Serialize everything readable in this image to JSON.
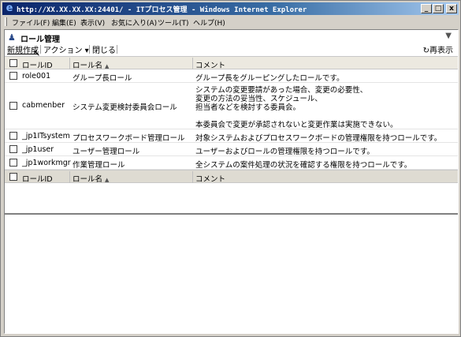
{
  "window": {
    "title": "http://XX.XX.XX.XX:24401/ - ITプロセス管理 - Windows Internet Explorer",
    "minimize": "_",
    "maximize": "□",
    "close": "x"
  },
  "menu": [
    "ファイル(F)",
    "編集(E)",
    "表示(V)",
    "お気に入り(A)",
    "ツール(T)",
    "ヘルプ(H)"
  ],
  "page": {
    "title": "ロール管理",
    "icon": "users-icon",
    "collapse_icon": "triangle-down-icon"
  },
  "toolbar": {
    "new": "新規作成",
    "action": "アクション ▾",
    "close": "閉じる",
    "refresh": "再表示",
    "refresh_icon": "refresh-icon"
  },
  "table": {
    "columns": {
      "id": "ロールID",
      "name": "ロール名",
      "comment": "コメント",
      "sort_indicator": "▲"
    },
    "rows": [
      {
        "id": "role001",
        "name": "グループ長ロール",
        "comment": [
          "グループ長をグルーピングしたロールです。"
        ]
      },
      {
        "id": "cabmenber",
        "name": "システム変更検討委員会ロール",
        "comment": [
          "システムの変更要請があった場合、変更の必要性、",
          "変更の方法の妥当性、スケジュール、",
          "担当者などを検討する委員会。",
          "",
          "本委員会で変更が承認されないと変更作業は実施できない。"
        ]
      },
      {
        "id": "_jp1ITsystem",
        "name": "プロセスワークボード管理ロール",
        "comment": [
          "対象システムおよびプロセスワークボードの管理権限を持つロールです。"
        ]
      },
      {
        "id": "_jp1user",
        "name": "ユーザー管理ロール",
        "comment": [
          "ユーザーおよびロールの管理権限を持つロールです。"
        ]
      },
      {
        "id": "_jp1workmgr",
        "name": "作業管理ロール",
        "comment": [
          "全システムの案件処理の状況を確認する権限を持つロールです。"
        ]
      }
    ]
  }
}
